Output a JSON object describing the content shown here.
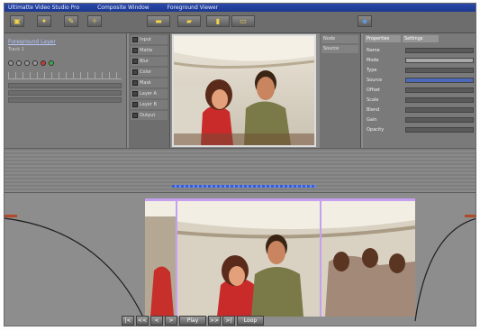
{
  "titlebar": {
    "segments": [
      "Ultimatte Video Studio Pro",
      "Composite Window",
      "Foreground Viewer"
    ]
  },
  "toolbar": {
    "icons": [
      "folder-icon",
      "star-icon",
      "pencil-icon",
      "wand-icon",
      "render-icon",
      "layers-icon",
      "export-icon",
      "monitor-icon",
      "network-icon"
    ]
  },
  "left_panel": {
    "header": "Foreground Layer",
    "sub": "Track 1"
  },
  "node_list": {
    "items": [
      "Input",
      "Matte",
      "Blur",
      "Color",
      "Mask",
      "Layer A",
      "Layer B",
      "Output"
    ]
  },
  "right_list": {
    "items": [
      "Node",
      "Source"
    ]
  },
  "props": {
    "tabs": [
      "Properties",
      "Settings"
    ],
    "rows": [
      {
        "label": "Name",
        "style": "dark"
      },
      {
        "label": "Mode",
        "style": "light"
      },
      {
        "label": "Type",
        "style": "dark"
      },
      {
        "label": "Source",
        "style": "blue"
      },
      {
        "label": "Offset",
        "style": "dark"
      },
      {
        "label": "Scale",
        "style": "dark"
      },
      {
        "label": "Blend",
        "style": "dark"
      },
      {
        "label": "Gain",
        "style": "dark"
      },
      {
        "label": "Opacity",
        "style": "dark"
      }
    ]
  },
  "bottom_bar": {
    "buttons": [
      "|<",
      "<<",
      "<",
      ">",
      "Play",
      ">>",
      ">|",
      "Loop"
    ]
  },
  "colors": {
    "accent": "#2a49a8",
    "panel": "#8c8c8c"
  }
}
